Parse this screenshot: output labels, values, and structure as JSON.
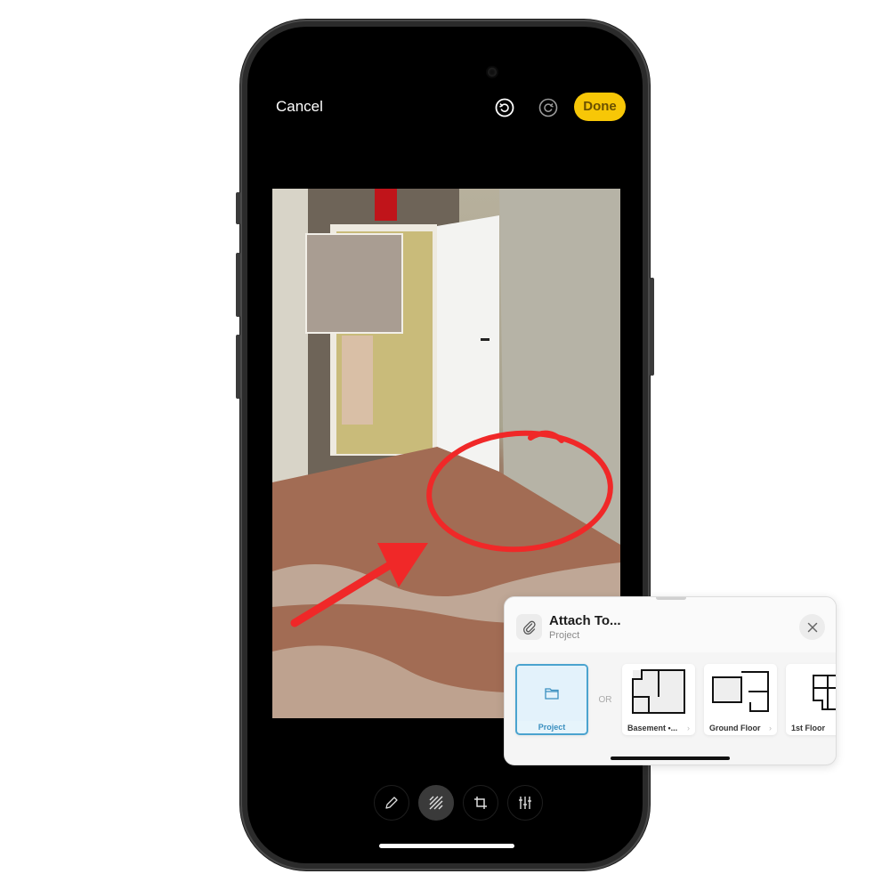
{
  "editor": {
    "cancel_label": "Cancel",
    "undo_icon": "undo-icon",
    "redo_icon": "redo-icon",
    "done_label": "Done",
    "accent_color": "#f7c707",
    "tools": [
      {
        "name": "markup-pen",
        "icon": "pencil-icon",
        "active": false
      },
      {
        "name": "blur",
        "icon": "blur-hatch-icon",
        "active": true
      },
      {
        "name": "crop",
        "icon": "crop-icon",
        "active": false
      },
      {
        "name": "adjust",
        "icon": "sliders-icon",
        "active": false
      }
    ]
  },
  "photo": {
    "description": "Basement corridor with open white door and water-damaged floor",
    "annotations": [
      "red-circle",
      "red-arrow",
      "blur-box"
    ],
    "annotation_color": "#f02828"
  },
  "attach_panel": {
    "title": "Attach To...",
    "subtitle": "Project",
    "close_icon": "close-icon",
    "or_label": "OR",
    "tiles": [
      {
        "label": "Project",
        "icon": "folder-icon",
        "selected": true
      },
      {
        "label": "Basement •...",
        "icon": "floorplan-thumbnail",
        "selected": false,
        "chevron": "›"
      },
      {
        "label": "Ground Floor",
        "icon": "floorplan-thumbnail",
        "selected": false,
        "chevron": "›"
      },
      {
        "label": "1st Floor",
        "icon": "floorplan-thumbnail",
        "selected": false
      }
    ]
  }
}
